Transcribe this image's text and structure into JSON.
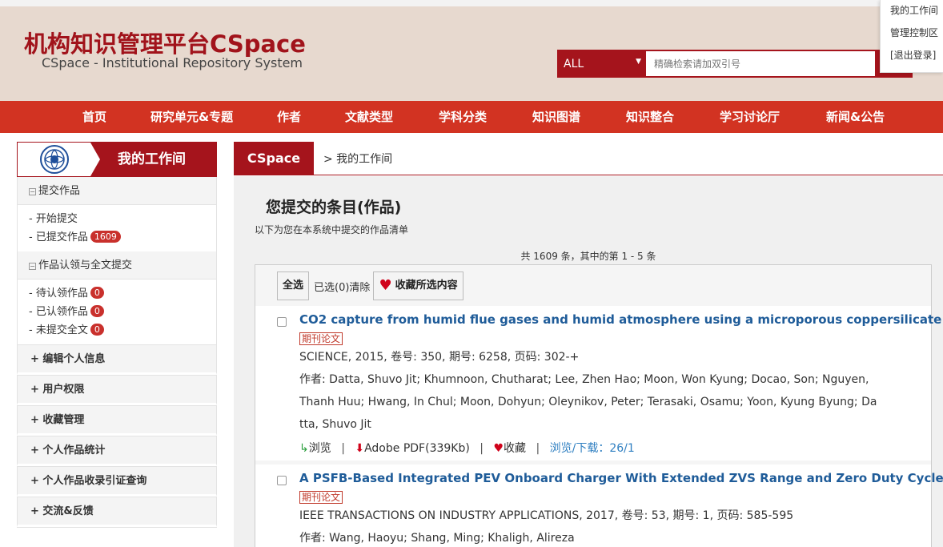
{
  "header": {
    "title": "机构知识管理平台CSpace",
    "subtitle": "CSpace - Institutional Repository System",
    "search": {
      "scope": "ALL",
      "placeholder": "精确检索请加双引号"
    },
    "user_menu": [
      "我的工作间",
      "管理控制区",
      "[退出登录]"
    ]
  },
  "nav": [
    "首页",
    "研究单元&专题",
    "作者",
    "文献类型",
    "学科分类",
    "知识图谱",
    "知识整合",
    "学习讨论厅",
    "新闻&公告"
  ],
  "sidebar": {
    "title": "我的工作间",
    "sections": [
      {
        "label": "提交作品",
        "items": [
          {
            "label": "- 开始提交",
            "badge": ""
          },
          {
            "label": "- 已提交作品",
            "badge": "1609"
          }
        ]
      },
      {
        "label": "作品认领与全文提交",
        "items": [
          {
            "label": "- 待认领作品",
            "badge": "0"
          },
          {
            "label": "- 已认领作品",
            "badge": "0"
          },
          {
            "label": "- 未提交全文",
            "badge": "0"
          }
        ]
      }
    ],
    "links": [
      "+ 编辑个人信息",
      "+ 用户权限",
      "+ 收藏管理",
      "+ 个人作品统计",
      "+ 个人作品收录引证查询",
      "+ 交流&反馈"
    ]
  },
  "breadcrumb": {
    "home": "CSpace",
    "current": "> 我的工作间"
  },
  "main": {
    "title": "您提交的条目(作品)",
    "subtitle": "以下为您在本系统中提交的作品清单",
    "count": "共 1609 条，其中的第 1 - 5 条",
    "toolbar": {
      "select_all": "全选",
      "selected": "已选(0)清除",
      "favorite": "收藏所选内容"
    },
    "items": [
      {
        "title": "CO2 capture from humid flue gases and humid atmosphere using a microporous coppersilicate",
        "tag": "期刊论文",
        "source": "SCIENCE, 2015, 卷号: 350, 期号: 6258, 页码: 302-+",
        "authors_lines": [
          "作者:  Datta, Shuvo Jit;  Khumnoon, Chutharat;  Lee, Zhen Hao;  Moon, Won Kyung;  Docao, Son;  Nguyen,",
          "Thanh Huu;  Hwang, In Chul;  Moon, Dohyun;  Oleynikov, Peter;  Terasaki, Osamu;  Yoon, Kyung Byung;  Da",
          "tta, Shuvo Jit"
        ],
        "actions": {
          "view": "浏览",
          "pdf": "Adobe PDF(339Kb)",
          "fav": "收藏",
          "stats": "浏览/下载：26/1"
        }
      },
      {
        "title": "A PSFB-Based Integrated PEV Onboard Charger With Extended ZVS Range and Zero Duty Cycle Loss",
        "tag": "期刊论文",
        "source": "IEEE TRANSACTIONS ON INDUSTRY APPLICATIONS, 2017, 卷号: 53, 期号: 1, 页码: 585-595",
        "authors_lines": [
          "作者:  Wang, Haoyu;  Shang, Ming;  Khaligh, Alireza"
        ]
      }
    ]
  },
  "colors": {
    "brand": "#a5141c",
    "nav": "#d23322",
    "header_bg": "#e7d9cf",
    "link": "#1f5c99"
  }
}
